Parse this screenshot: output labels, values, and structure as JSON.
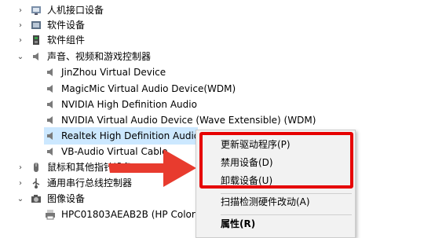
{
  "tree": {
    "items": [
      {
        "label": "人机接口设备",
        "expanded": false,
        "icon": "hid-icon"
      },
      {
        "label": "软件设备",
        "expanded": false,
        "icon": "software-device-icon"
      },
      {
        "label": "软件组件",
        "expanded": false,
        "icon": "software-component-icon"
      },
      {
        "label": "声音、视频和游戏控制器",
        "expanded": true,
        "icon": "speaker-icon"
      },
      {
        "label": "JinZhou Virtual Device",
        "icon": "speaker-icon"
      },
      {
        "label": "MagicMic Virtual Audio Device(WDM)",
        "icon": "speaker-icon"
      },
      {
        "label": "NVIDIA High Definition Audio",
        "icon": "speaker-icon"
      },
      {
        "label": "NVIDIA Virtual Audio Device (Wave Extensible) (WDM)",
        "icon": "speaker-icon"
      },
      {
        "label": "Realtek High Definition Audio",
        "icon": "speaker-icon",
        "selected": true
      },
      {
        "label": "VB-Audio Virtual Cable",
        "icon": "speaker-icon"
      },
      {
        "label": "鼠标和其他指针设备",
        "expanded": false,
        "icon": "mouse-icon"
      },
      {
        "label": "通用串行总线控制器",
        "expanded": false,
        "icon": "usb-icon"
      },
      {
        "label": "图像设备",
        "expanded": true,
        "icon": "camera-icon"
      },
      {
        "label": "HPC01803AEAB2B (HP Color",
        "icon": "printer-icon"
      }
    ]
  },
  "context_menu": {
    "update_driver": "更新驱动程序(P)",
    "disable_device": "禁用设备(D)",
    "uninstall_device": "卸载设备(U)",
    "scan_hardware": "扫描检测硬件改动(A)",
    "properties": "属性(R)"
  },
  "colors": {
    "highlight": "#e60000",
    "selection": "#cce8ff"
  }
}
